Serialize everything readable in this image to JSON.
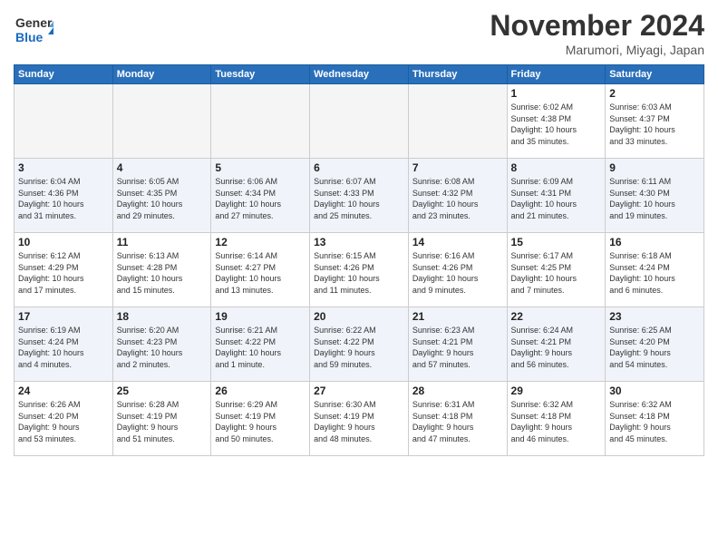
{
  "header": {
    "logo_general": "General",
    "logo_blue": "Blue",
    "month": "November 2024",
    "location": "Marumori, Miyagi, Japan"
  },
  "days_of_week": [
    "Sunday",
    "Monday",
    "Tuesday",
    "Wednesday",
    "Thursday",
    "Friday",
    "Saturday"
  ],
  "weeks": [
    [
      {
        "day": "",
        "info": ""
      },
      {
        "day": "",
        "info": ""
      },
      {
        "day": "",
        "info": ""
      },
      {
        "day": "",
        "info": ""
      },
      {
        "day": "",
        "info": ""
      },
      {
        "day": "1",
        "info": "Sunrise: 6:02 AM\nSunset: 4:38 PM\nDaylight: 10 hours\nand 35 minutes."
      },
      {
        "day": "2",
        "info": "Sunrise: 6:03 AM\nSunset: 4:37 PM\nDaylight: 10 hours\nand 33 minutes."
      }
    ],
    [
      {
        "day": "3",
        "info": "Sunrise: 6:04 AM\nSunset: 4:36 PM\nDaylight: 10 hours\nand 31 minutes."
      },
      {
        "day": "4",
        "info": "Sunrise: 6:05 AM\nSunset: 4:35 PM\nDaylight: 10 hours\nand 29 minutes."
      },
      {
        "day": "5",
        "info": "Sunrise: 6:06 AM\nSunset: 4:34 PM\nDaylight: 10 hours\nand 27 minutes."
      },
      {
        "day": "6",
        "info": "Sunrise: 6:07 AM\nSunset: 4:33 PM\nDaylight: 10 hours\nand 25 minutes."
      },
      {
        "day": "7",
        "info": "Sunrise: 6:08 AM\nSunset: 4:32 PM\nDaylight: 10 hours\nand 23 minutes."
      },
      {
        "day": "8",
        "info": "Sunrise: 6:09 AM\nSunset: 4:31 PM\nDaylight: 10 hours\nand 21 minutes."
      },
      {
        "day": "9",
        "info": "Sunrise: 6:11 AM\nSunset: 4:30 PM\nDaylight: 10 hours\nand 19 minutes."
      }
    ],
    [
      {
        "day": "10",
        "info": "Sunrise: 6:12 AM\nSunset: 4:29 PM\nDaylight: 10 hours\nand 17 minutes."
      },
      {
        "day": "11",
        "info": "Sunrise: 6:13 AM\nSunset: 4:28 PM\nDaylight: 10 hours\nand 15 minutes."
      },
      {
        "day": "12",
        "info": "Sunrise: 6:14 AM\nSunset: 4:27 PM\nDaylight: 10 hours\nand 13 minutes."
      },
      {
        "day": "13",
        "info": "Sunrise: 6:15 AM\nSunset: 4:26 PM\nDaylight: 10 hours\nand 11 minutes."
      },
      {
        "day": "14",
        "info": "Sunrise: 6:16 AM\nSunset: 4:26 PM\nDaylight: 10 hours\nand 9 minutes."
      },
      {
        "day": "15",
        "info": "Sunrise: 6:17 AM\nSunset: 4:25 PM\nDaylight: 10 hours\nand 7 minutes."
      },
      {
        "day": "16",
        "info": "Sunrise: 6:18 AM\nSunset: 4:24 PM\nDaylight: 10 hours\nand 6 minutes."
      }
    ],
    [
      {
        "day": "17",
        "info": "Sunrise: 6:19 AM\nSunset: 4:24 PM\nDaylight: 10 hours\nand 4 minutes."
      },
      {
        "day": "18",
        "info": "Sunrise: 6:20 AM\nSunset: 4:23 PM\nDaylight: 10 hours\nand 2 minutes."
      },
      {
        "day": "19",
        "info": "Sunrise: 6:21 AM\nSunset: 4:22 PM\nDaylight: 10 hours\nand 1 minute."
      },
      {
        "day": "20",
        "info": "Sunrise: 6:22 AM\nSunset: 4:22 PM\nDaylight: 9 hours\nand 59 minutes."
      },
      {
        "day": "21",
        "info": "Sunrise: 6:23 AM\nSunset: 4:21 PM\nDaylight: 9 hours\nand 57 minutes."
      },
      {
        "day": "22",
        "info": "Sunrise: 6:24 AM\nSunset: 4:21 PM\nDaylight: 9 hours\nand 56 minutes."
      },
      {
        "day": "23",
        "info": "Sunrise: 6:25 AM\nSunset: 4:20 PM\nDaylight: 9 hours\nand 54 minutes."
      }
    ],
    [
      {
        "day": "24",
        "info": "Sunrise: 6:26 AM\nSunset: 4:20 PM\nDaylight: 9 hours\nand 53 minutes."
      },
      {
        "day": "25",
        "info": "Sunrise: 6:28 AM\nSunset: 4:19 PM\nDaylight: 9 hours\nand 51 minutes."
      },
      {
        "day": "26",
        "info": "Sunrise: 6:29 AM\nSunset: 4:19 PM\nDaylight: 9 hours\nand 50 minutes."
      },
      {
        "day": "27",
        "info": "Sunrise: 6:30 AM\nSunset: 4:19 PM\nDaylight: 9 hours\nand 48 minutes."
      },
      {
        "day": "28",
        "info": "Sunrise: 6:31 AM\nSunset: 4:18 PM\nDaylight: 9 hours\nand 47 minutes."
      },
      {
        "day": "29",
        "info": "Sunrise: 6:32 AM\nSunset: 4:18 PM\nDaylight: 9 hours\nand 46 minutes."
      },
      {
        "day": "30",
        "info": "Sunrise: 6:32 AM\nSunset: 4:18 PM\nDaylight: 9 hours\nand 45 minutes."
      }
    ]
  ]
}
